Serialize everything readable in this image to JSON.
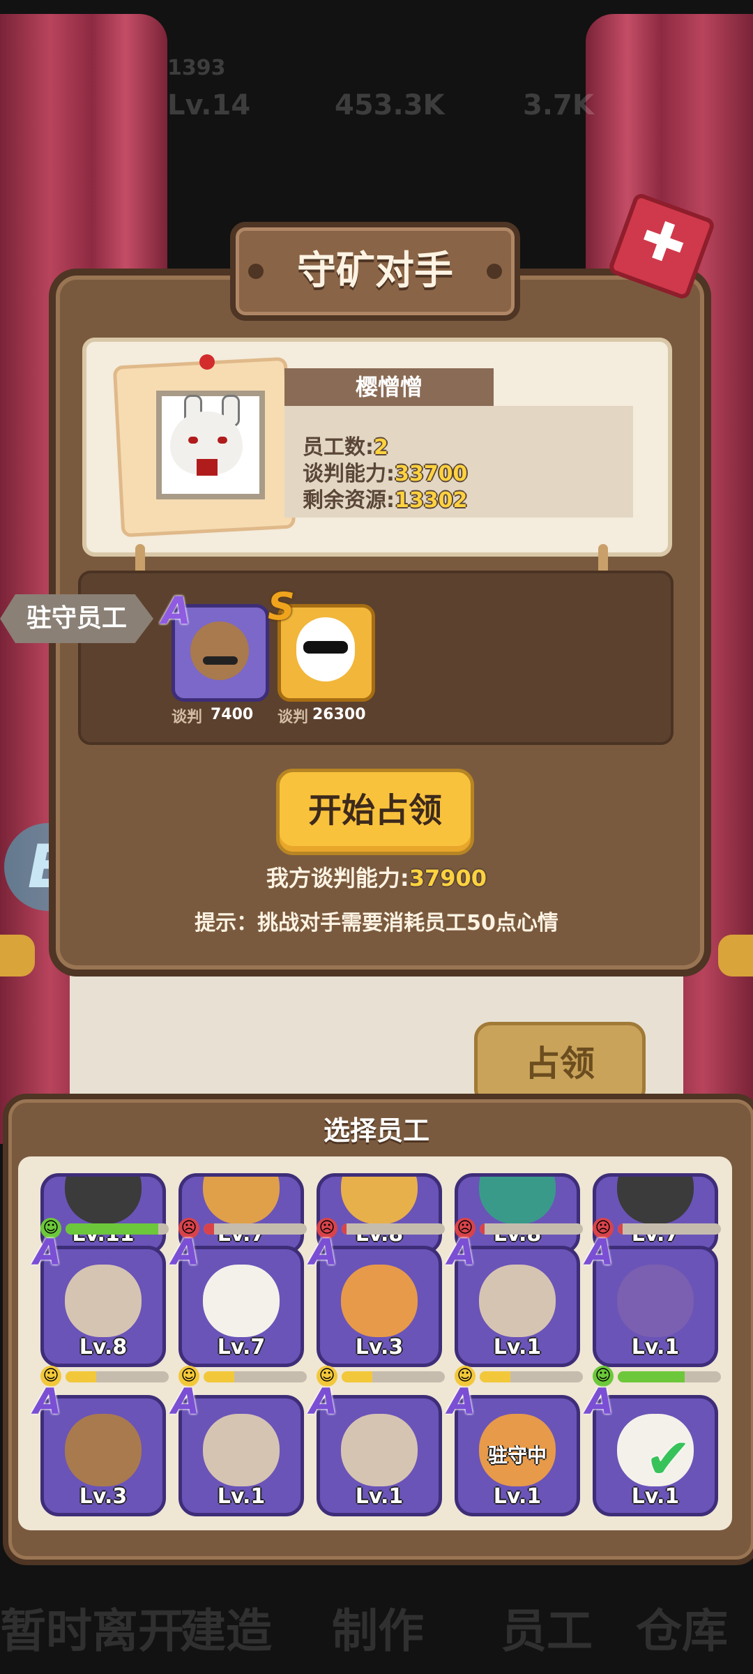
{
  "top_bar": {
    "item1": "1393",
    "item2": "Lv.14",
    "item3": "453.3K",
    "item4": "3.7K"
  },
  "dialog": {
    "title": "守矿对手",
    "opponent": {
      "name": "樱憎憎",
      "employee_count_label": "员工数:",
      "employee_count": "2",
      "negotiation_label": "谈判能力:",
      "negotiation": "33700",
      "remaining_label": "剩余资源:",
      "remaining": "13302"
    },
    "guards_sign": "驻守员工",
    "guards": [
      {
        "rank": "A",
        "stat_label": "谈判",
        "stat_value": "7400",
        "rank_color": "#8f5be0",
        "card_color": "#7b68c8"
      },
      {
        "rank": "S",
        "stat_label": "谈判",
        "stat_value": "26300",
        "rank_color": "#f0a41e",
        "card_color": "#f2b63a"
      }
    ],
    "start_button": "开始占领",
    "our_power_label": "我方谈判能力:",
    "our_power": "37900",
    "tip": "提示：挑战对手需要消耗员工50点心情"
  },
  "background": {
    "claim_button": "占领",
    "badge": "E"
  },
  "bottom_nav": [
    "暂时离开",
    "建造",
    "制作",
    "员工",
    "仓库"
  ],
  "select_panel": {
    "title": "选择员工",
    "rows": [
      [
        {
          "rank": "",
          "level": "Lv.11",
          "mood": "good",
          "mood_fill": 0.9,
          "face": "#3b3b3b"
        },
        {
          "rank": "",
          "level": "Lv.7",
          "mood": "bad",
          "mood_fill": 0.1,
          "face": "#e0a04a"
        },
        {
          "rank": "",
          "level": "Lv.8",
          "mood": "bad",
          "mood_fill": 0.05,
          "face": "#e8b04a"
        },
        {
          "rank": "",
          "level": "Lv.8",
          "mood": "bad",
          "mood_fill": 0.05,
          "face": "#3a9a8a"
        },
        {
          "rank": "",
          "level": "Lv.7",
          "mood": "bad",
          "mood_fill": 0.05,
          "face": "#3b3b3b"
        }
      ],
      [
        {
          "rank": "A",
          "level": "Lv.8",
          "mood": "ok",
          "mood_fill": 0.3,
          "face": "#d6c4b2"
        },
        {
          "rank": "A",
          "level": "Lv.7",
          "mood": "ok",
          "mood_fill": 0.3,
          "face": "#f4f1ea"
        },
        {
          "rank": "A",
          "level": "Lv.3",
          "mood": "ok",
          "mood_fill": 0.3,
          "face": "#e79a4a"
        },
        {
          "rank": "A",
          "level": "Lv.1",
          "mood": "ok",
          "mood_fill": 0.3,
          "face": "#d6c4b2"
        },
        {
          "rank": "A",
          "level": "Lv.1",
          "mood": "good",
          "mood_fill": 0.65,
          "face": "#7b5fb0"
        }
      ],
      [
        {
          "rank": "A",
          "level": "Lv.3",
          "mood": "",
          "mood_fill": 0,
          "face": "#a97a4e"
        },
        {
          "rank": "A",
          "level": "Lv.1",
          "mood": "",
          "mood_fill": 0,
          "face": "#d6c4b2"
        },
        {
          "rank": "A",
          "level": "Lv.1",
          "mood": "",
          "mood_fill": 0,
          "face": "#d6c4b2"
        },
        {
          "rank": "A",
          "level": "Lv.1",
          "mood": "",
          "mood_fill": 0,
          "face": "#e79a4a",
          "tag": "驻守中"
        },
        {
          "rank": "A",
          "level": "Lv.1",
          "mood": "",
          "mood_fill": 0,
          "face": "#f4f1ea",
          "checked": true
        }
      ]
    ]
  },
  "colors": {
    "mood_good": "#6cc83a",
    "mood_ok": "#f2c83a",
    "mood_bad": "#d8434b"
  }
}
